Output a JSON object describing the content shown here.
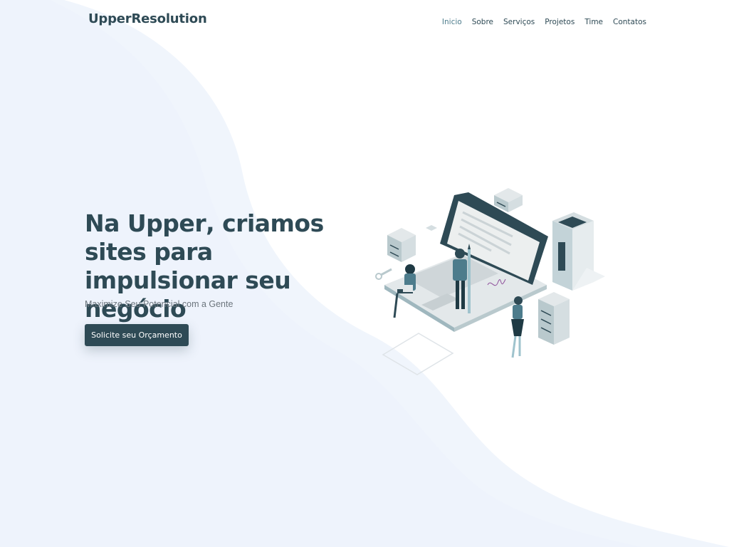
{
  "brand": {
    "name": "UpperResolution"
  },
  "nav": {
    "items": [
      {
        "label": "Inicio"
      },
      {
        "label": "Sobre"
      },
      {
        "label": "Serviços"
      },
      {
        "label": "Projetos"
      },
      {
        "label": "Time"
      },
      {
        "label": "Contatos"
      }
    ],
    "active_index": 0
  },
  "hero": {
    "title_before": "Na ",
    "title_bold": "Upper",
    "title_after": ", criamos sites para impulsionar seu negócio",
    "subtitle": "Maximize Seu Potencial com a Gente",
    "cta_label": "Solicite seu Orçamento"
  },
  "colors": {
    "primary": "#2e4a55",
    "accent": "#4d7c8c",
    "background_wave": "#f0f5fc",
    "muted_text": "#6c757d"
  },
  "illustration": {
    "description_icon": "isometric-laptop-servers-people-illustration"
  }
}
